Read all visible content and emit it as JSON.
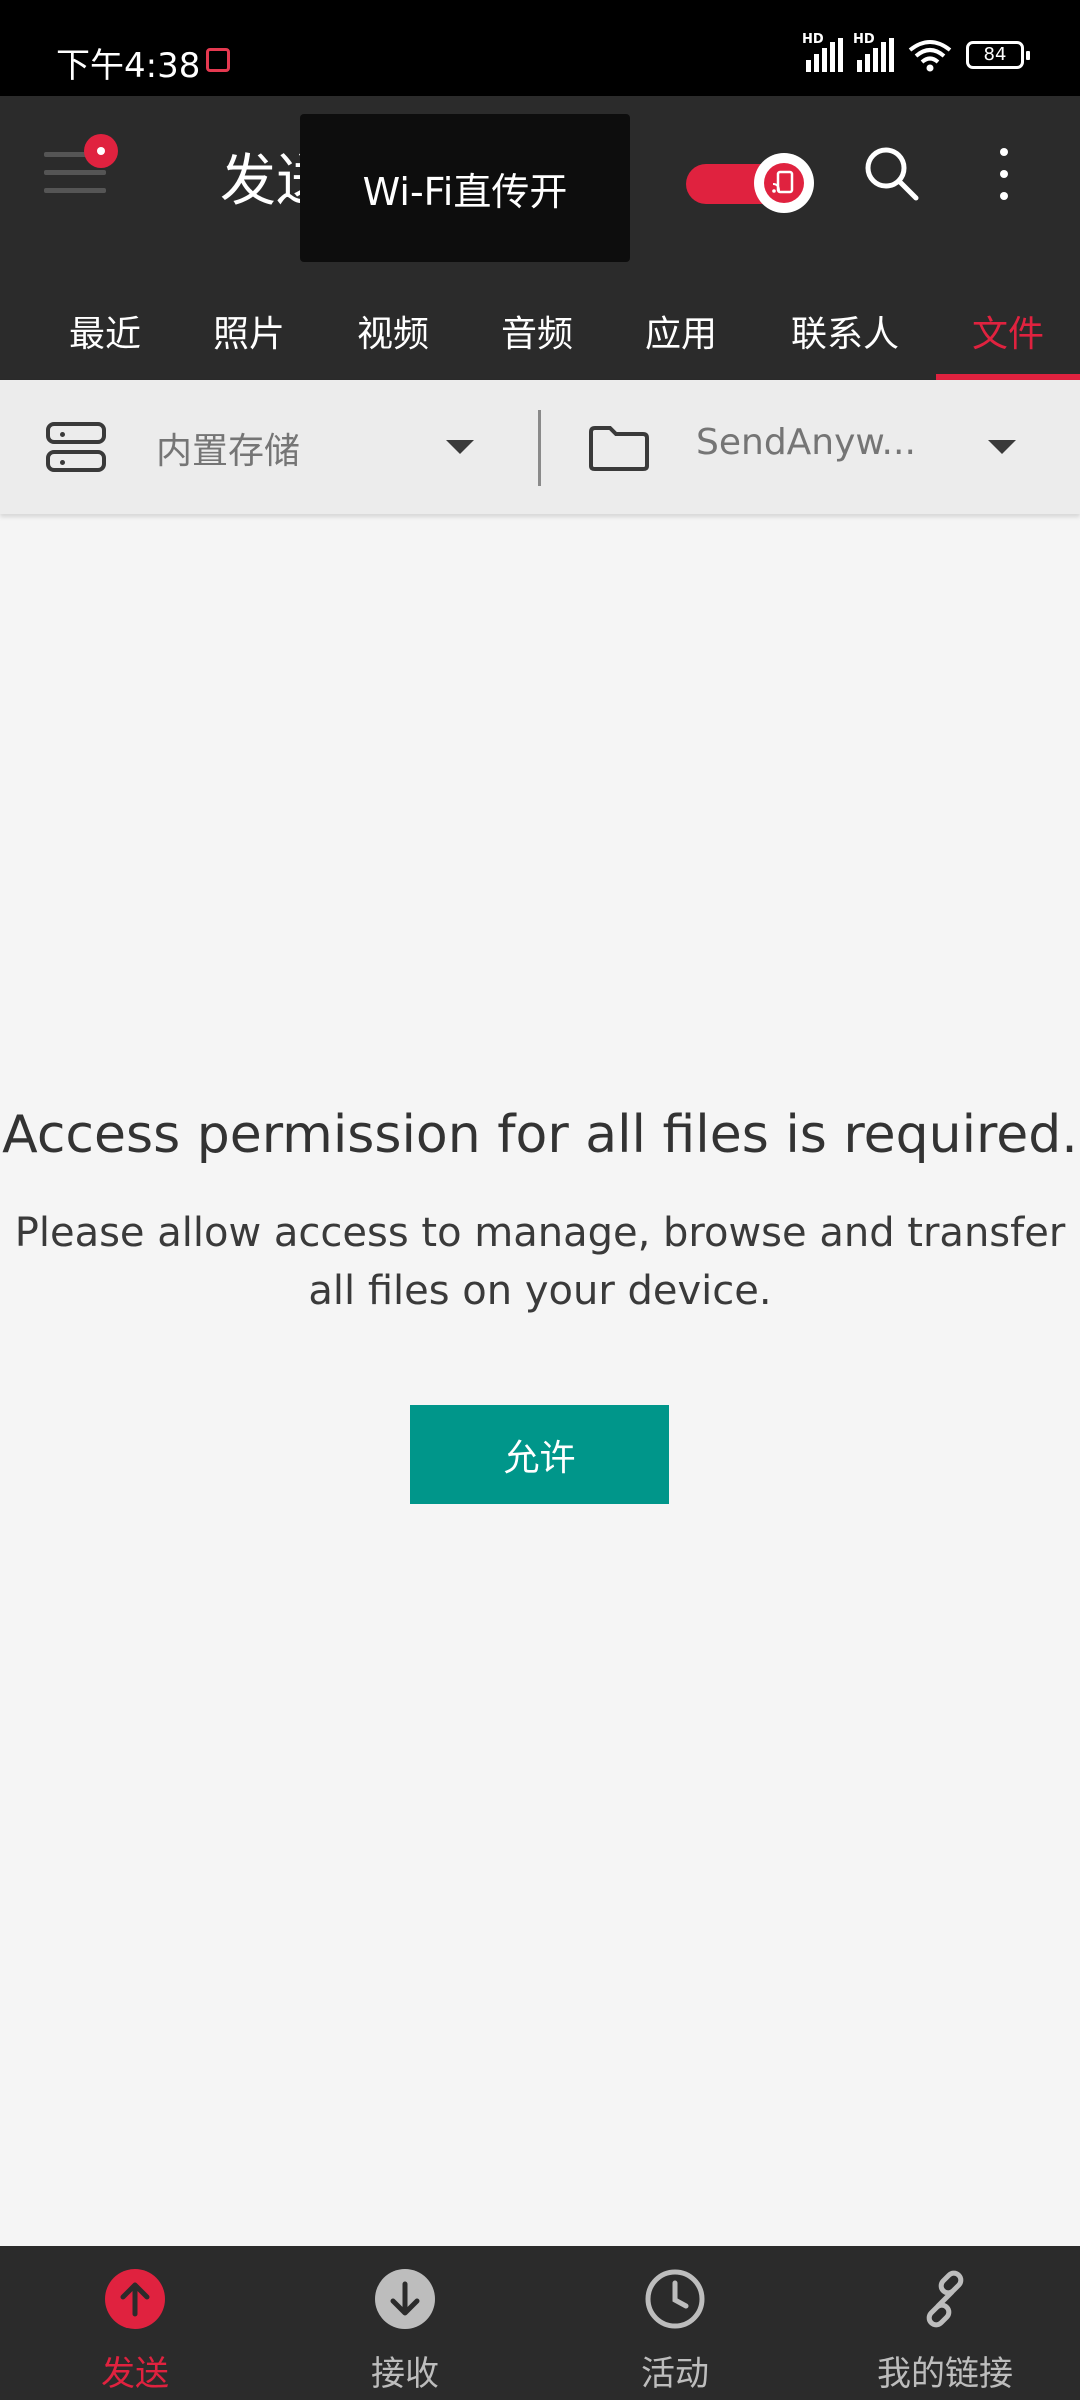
{
  "status_bar": {
    "time": "下午4:38",
    "signal_labels": [
      "HD",
      "HD"
    ],
    "battery": "84"
  },
  "app_bar": {
    "title": "发送",
    "tooltip": "Wi-Fi直传开",
    "toggle_on": true,
    "icons": [
      "menu-icon",
      "cast-icon",
      "search-icon",
      "more-vert-icon"
    ]
  },
  "tabs": [
    {
      "label": "最近",
      "active": false
    },
    {
      "label": "照片",
      "active": false
    },
    {
      "label": "视频",
      "active": false
    },
    {
      "label": "音频",
      "active": false
    },
    {
      "label": "应用",
      "active": false
    },
    {
      "label": "联系人",
      "active": false
    },
    {
      "label": "文件",
      "active": true
    }
  ],
  "storage": {
    "storage_label": "内置存储",
    "folder_label": "SendAnyw..."
  },
  "message": {
    "title": "Access permission for all files is required.",
    "body": "Please allow access to manage, browse and transfer all files on your device.",
    "button": "允许"
  },
  "bottom_nav": [
    {
      "label": "发送",
      "icon": "upload-icon",
      "active": true
    },
    {
      "label": "接收",
      "icon": "download-icon",
      "active": false
    },
    {
      "label": "活动",
      "icon": "clock-icon",
      "active": false
    },
    {
      "label": "我的链接",
      "icon": "link-icon",
      "active": false
    }
  ],
  "colors": {
    "accent": "#e0223f",
    "button": "#00968a",
    "bar": "#2b2b2b"
  }
}
